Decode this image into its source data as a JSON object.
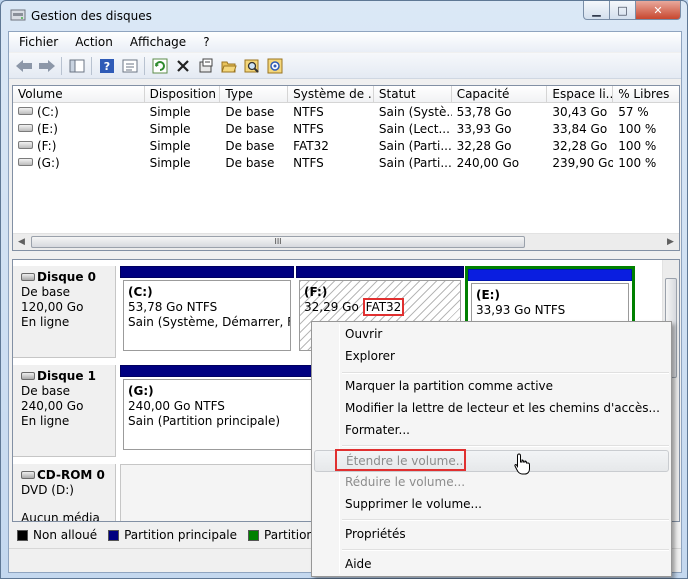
{
  "window": {
    "title": "Gestion des disques"
  },
  "menubar": {
    "items": [
      "Fichier",
      "Action",
      "Affichage",
      "?"
    ]
  },
  "toolbar": {
    "icons": [
      "back-arrow-icon",
      "forward-arrow-icon",
      "console-tree-icon",
      "help-icon",
      "properties-icon",
      "refresh-icon",
      "delete-icon",
      "settings-icon",
      "open-folder-icon",
      "search-icon",
      "rescan-icon"
    ]
  },
  "list": {
    "columns": [
      "Volume",
      "Disposition",
      "Type",
      "Système de ...",
      "Statut",
      "Capacité",
      "Espace li...",
      "% Libres"
    ],
    "rows": [
      [
        "(C:)",
        "Simple",
        "De base",
        "NTFS",
        "Sain (Systè...",
        "53,78 Go",
        "30,43 Go",
        "57 %"
      ],
      [
        "(E:)",
        "Simple",
        "De base",
        "NTFS",
        "Sain (Lect...",
        "33,93 Go",
        "33,84 Go",
        "100 %"
      ],
      [
        "(F:)",
        "Simple",
        "De base",
        "FAT32",
        "Sain (Parti...",
        "32,28 Go",
        "32,28 Go",
        "100 %"
      ],
      [
        "(G:)",
        "Simple",
        "De base",
        "NTFS",
        "Sain (Parti...",
        "240,00 Go",
        "239,90 Go",
        "100 %"
      ]
    ],
    "scroll_thumb_grip": "III"
  },
  "disks": [
    {
      "name": "Disque 0",
      "type": "De base",
      "size": "120,00 Go",
      "status": "En ligne",
      "partitions": [
        {
          "label": "(C:)",
          "size_fs": "53,78 Go NTFS",
          "status": "Sain (Système, Démarrer, Fichi"
        },
        {
          "label": "(F:)",
          "size": "32,29 Go",
          "fs": "FAT32"
        },
        {
          "label": "(E:)",
          "size_fs": "33,93 Go NTFS"
        }
      ]
    },
    {
      "name": "Disque 1",
      "type": "De base",
      "size": "240,00 Go",
      "status": "En ligne",
      "partitions": [
        {
          "label": "(G:)",
          "size_fs": "240,00 Go NTFS",
          "status": "Sain (Partition principale)"
        }
      ]
    },
    {
      "name": "CD-ROM 0",
      "type": "DVD (D:)",
      "status": "Aucun média"
    }
  ],
  "legend": [
    {
      "label": "Non alloué",
      "color": "#000000"
    },
    {
      "label": "Partition principale",
      "color": "#000080"
    },
    {
      "label": "Partition étend",
      "color": "#008000"
    }
  ],
  "context_menu": {
    "items": [
      {
        "label": "Ouvrir",
        "enabled": true
      },
      {
        "label": "Explorer",
        "enabled": true
      },
      {
        "label": "Marquer la partition comme active",
        "enabled": true
      },
      {
        "label": "Modifier la lettre de lecteur et les chemins d'accès...",
        "enabled": true
      },
      {
        "label": "Formater...",
        "enabled": true
      },
      {
        "label": "Étendre le volume...",
        "enabled": false
      },
      {
        "label": "Réduire le volume...",
        "enabled": false
      },
      {
        "label": "Supprimer le volume...",
        "enabled": true
      },
      {
        "label": "Propriétés",
        "enabled": true
      },
      {
        "label": "Aide",
        "enabled": true
      }
    ]
  },
  "colors": {
    "primary_partition": "#000080",
    "highlight_box": "#e03030",
    "selection": "#008000"
  }
}
